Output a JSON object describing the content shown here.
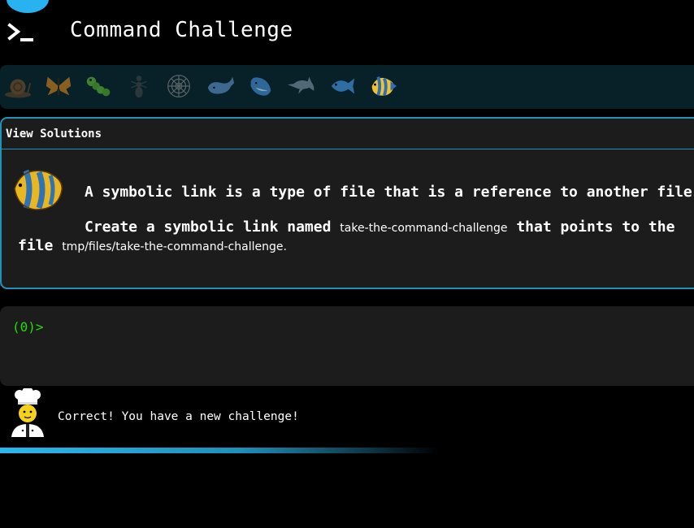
{
  "header": {
    "title": "Command Challenge",
    "icon": "terminal-icon",
    "accent_color": "#28b3f0"
  },
  "levels": [
    {
      "icon": "snail-icon",
      "state": "dim"
    },
    {
      "icon": "butterfly-icon",
      "state": "dim"
    },
    {
      "icon": "caterpillar-icon",
      "state": "dim"
    },
    {
      "icon": "ant-icon",
      "state": "dim"
    },
    {
      "icon": "spider-web-icon",
      "state": "dim"
    },
    {
      "icon": "whale-icon",
      "state": "dim"
    },
    {
      "icon": "spouting-whale-icon",
      "state": "dim"
    },
    {
      "icon": "dolphin-icon",
      "state": "dim"
    },
    {
      "icon": "fish-icon",
      "state": "dim"
    },
    {
      "icon": "tropical-fish-icon",
      "state": "active"
    }
  ],
  "panel": {
    "view_solutions": "View Solutions",
    "line1": "A symbolic link is a type of file that is a reference to another file.",
    "line2_prefix": "Create a symbolic link named ",
    "link_name": "take-the-command-challenge",
    "line2_suffix": " that points to the",
    "line3_prefix": "file ",
    "target_path": "tmp/files/take-the-command-challenge",
    "line3_suffix": "."
  },
  "console": {
    "prompt": "(0)>",
    "prompt_color": "#1ee000"
  },
  "feedback": {
    "message": "Correct! You have a new challenge!",
    "avatar": "chef-icon"
  },
  "progress": {
    "fraction": 0.63
  }
}
